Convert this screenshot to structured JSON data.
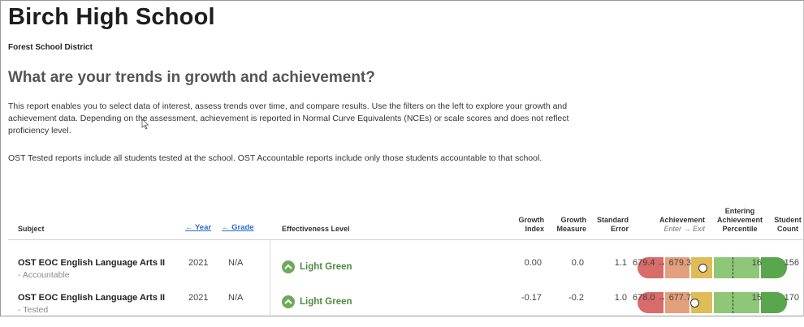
{
  "school": {
    "name": "Birch High School",
    "district": "Forest School District"
  },
  "question": "What are your trends in growth and achievement?",
  "description": [
    "This report enables you to select data of interest, assess trends over time, and compare results. Use the filters on the left to explore your growth and achievement data. Depending on the assessment, achievement is reported in Normal Curve Equivalents (NCEs) or scale scores and does not reflect proficiency level.",
    "OST Tested reports include all students tested at the school. OST Accountable reports include only those students accountable to that school."
  ],
  "table": {
    "headers": {
      "subject": "Subject",
      "year": "← Year",
      "grade": "← Grade",
      "effectiveness": "Effectiveness Level",
      "growth_index_1": "Growth",
      "growth_index_2": "Index",
      "growth_measure_1": "Growth",
      "growth_measure_2": "Measure",
      "standard_error_1": "Standard",
      "standard_error_2": "Error",
      "achievement": "Achievement",
      "achievement_sub": "Enter → Exit",
      "percentile_1": "Entering",
      "percentile_2": "Achievement",
      "percentile_3": "Percentile",
      "count_1": "Student",
      "count_2": "Count"
    },
    "rows": [
      {
        "subject": "OST EOC English Language Arts II",
        "subtype": "- Accountable",
        "year": "2021",
        "grade": "N/A",
        "effectiveness": "Light Green",
        "growth_index": "0.00",
        "growth_measure": "0.0",
        "standard_error": "1.1",
        "achievement": "679.4 → 679.3",
        "percentile": "16",
        "count": "156",
        "marker_position": 0.44
      },
      {
        "subject": "OST EOC English Language Arts II",
        "subtype": "- Tested",
        "year": "2021",
        "grade": "N/A",
        "effectiveness": "Light Green",
        "growth_index": "-0.17",
        "growth_measure": "-0.2",
        "standard_error": "1.0",
        "achievement": "678.0 → 677.7",
        "percentile": "15",
        "count": "170",
        "marker_position": 0.385
      }
    ]
  },
  "colors": {
    "accent_link": "#2a6ec9",
    "effectiveness_green": "#6bab5b",
    "scale": [
      "#d96b6a",
      "#e4a07c",
      "#e0bc57",
      "#8ec778",
      "#5aa64d"
    ]
  }
}
